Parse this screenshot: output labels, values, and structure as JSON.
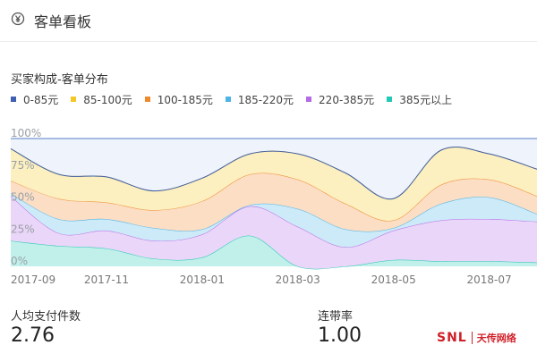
{
  "header": {
    "title": "客单看板",
    "icon": "yuan-circle-icon"
  },
  "section_title": "买家构成-客单分布",
  "colors": [
    "#3f5fb0",
    "#f4c923",
    "#ef8a2c",
    "#4db4e6",
    "#b46be6",
    "#22c9b4"
  ],
  "chart_data": {
    "type": "area",
    "stacked": true,
    "normalized": true,
    "title": "",
    "x": [
      "2017-09",
      "2017-10",
      "2017-11",
      "2017-12",
      "2018-01",
      "2018-02",
      "2018-03",
      "2018-04",
      "2018-05",
      "2018-06",
      "2018-07",
      "2018-08"
    ],
    "x_ticks": [
      "2017-09",
      "2017-11",
      "2018-01",
      "2018-03",
      "2018-05",
      "2018-07"
    ],
    "y_ticks": [
      "0%",
      "25%",
      "50%",
      "75%",
      "100%"
    ],
    "ylim": [
      0,
      100
    ],
    "series": [
      {
        "name": "0-85元",
        "values": [
          0,
          0,
          0,
          0,
          0,
          0,
          0,
          0,
          0,
          0,
          0,
          0
        ]
      },
      {
        "name": "85-100元",
        "values": [
          25,
          19,
          20,
          15,
          18,
          16,
          20,
          24,
          17,
          27,
          20,
          21
        ]
      },
      {
        "name": "100-185元",
        "values": [
          10,
          16,
          13,
          14,
          22,
          24,
          23,
          20,
          6,
          15,
          14,
          14
        ]
      },
      {
        "name": "185-220元",
        "values": [
          2,
          11,
          9,
          10,
          4,
          1,
          14,
          14,
          2,
          13,
          17,
          6
        ]
      },
      {
        "name": "220-385元",
        "values": [
          35,
          10,
          14,
          14,
          18,
          23,
          31,
          15,
          23,
          32,
          33,
          32
        ]
      },
      {
        "name": "385元以上",
        "values": [
          20,
          16,
          14,
          6,
          7,
          24,
          0,
          0,
          5,
          4,
          4,
          3
        ]
      }
    ]
  },
  "metrics": [
    {
      "label": "人均支付件数",
      "value": "2.76"
    },
    {
      "label": "连带率",
      "value": "1.00"
    }
  ],
  "watermark": {
    "brand": "SNL",
    "cn": "天传网络"
  }
}
